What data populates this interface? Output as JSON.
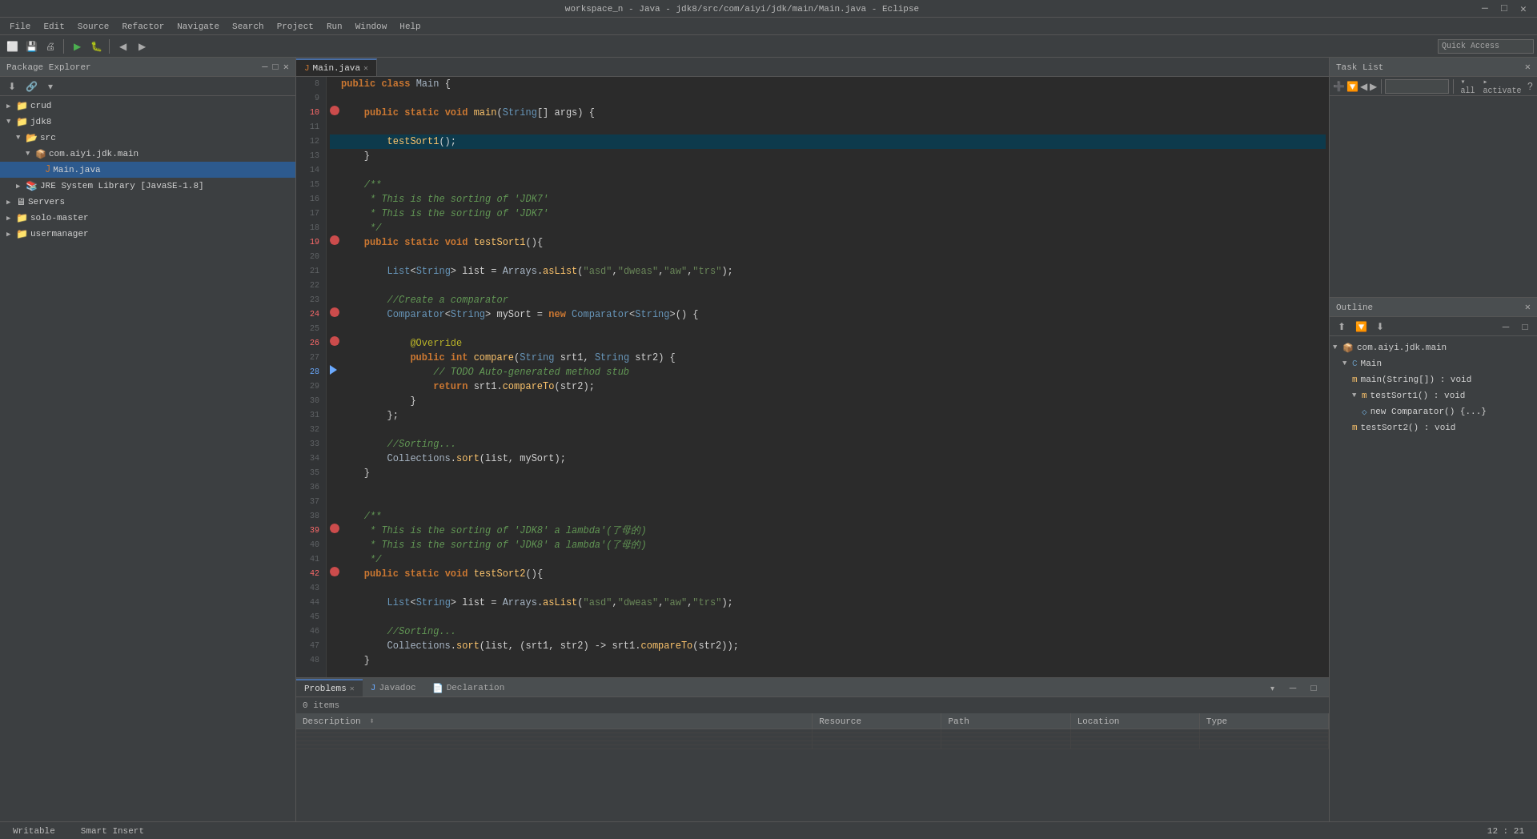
{
  "titleBar": {
    "title": "workspace_n - Java - jdk8/src/com/aiyi/jdk/main/Main.java - Eclipse",
    "minimize": "─",
    "maximize": "□",
    "close": "✕"
  },
  "menuBar": {
    "items": [
      "File",
      "Edit",
      "Source",
      "Refactor",
      "Navigate",
      "Search",
      "Project",
      "Run",
      "Window",
      "Help"
    ]
  },
  "toolbar": {
    "quickAccessPlaceholder": "Quick Access"
  },
  "leftPanel": {
    "title": "Package Explorer",
    "treeItems": [
      {
        "label": "crud",
        "level": 1,
        "expanded": true,
        "type": "project",
        "icon": "📁"
      },
      {
        "label": "jdk8",
        "level": 1,
        "expanded": true,
        "type": "project",
        "icon": "📁"
      },
      {
        "label": "src",
        "level": 2,
        "expanded": true,
        "type": "folder",
        "icon": "📂"
      },
      {
        "label": "com.aiyi.jdk.main",
        "level": 3,
        "expanded": true,
        "type": "package",
        "icon": "📦"
      },
      {
        "label": "Main.java",
        "level": 4,
        "expanded": false,
        "type": "file",
        "icon": "☕",
        "selected": true
      },
      {
        "label": "JRE System Library [JavaSE-1.8]",
        "level": 2,
        "expanded": false,
        "type": "library",
        "icon": "📚"
      },
      {
        "label": "Servers",
        "level": 1,
        "expanded": false,
        "type": "folder",
        "icon": "🖥"
      },
      {
        "label": "solo-master",
        "level": 1,
        "expanded": false,
        "type": "project",
        "icon": "📁"
      },
      {
        "label": "usermanager",
        "level": 1,
        "expanded": false,
        "type": "project",
        "icon": "📁"
      }
    ]
  },
  "editorTab": {
    "fileName": "Main.java",
    "active": true
  },
  "codeLines": [
    {
      "num": 8,
      "content": "public class Main {",
      "type": "normal"
    },
    {
      "num": 9,
      "content": "",
      "type": "normal"
    },
    {
      "num": 10,
      "content": "    public static void main(String[] args) {",
      "type": "breakpoint"
    },
    {
      "num": 11,
      "content": "",
      "type": "normal"
    },
    {
      "num": 12,
      "content": "        testSort1();",
      "type": "current"
    },
    {
      "num": 13,
      "content": "    }",
      "type": "normal"
    },
    {
      "num": 14,
      "content": "",
      "type": "normal"
    },
    {
      "num": 15,
      "content": "    /**",
      "type": "normal"
    },
    {
      "num": 16,
      "content": "     * This is the sorting of 'JDK7'",
      "type": "normal"
    },
    {
      "num": 17,
      "content": "     * This is the sorting of 'JDK7'",
      "type": "normal"
    },
    {
      "num": 18,
      "content": "     */",
      "type": "normal"
    },
    {
      "num": 19,
      "content": "    public static void testSort1(){",
      "type": "breakpoint"
    },
    {
      "num": 20,
      "content": "",
      "type": "normal"
    },
    {
      "num": 21,
      "content": "        List<String> list = Arrays.asList(\"asd\",\"dweas\",\"aw\",\"trs\");",
      "type": "normal"
    },
    {
      "num": 22,
      "content": "",
      "type": "normal"
    },
    {
      "num": 23,
      "content": "        //Create a comparator",
      "type": "normal"
    },
    {
      "num": 24,
      "content": "        Comparator<String> mySort = new Comparator<String>() {",
      "type": "breakpoint"
    },
    {
      "num": 25,
      "content": "",
      "type": "normal"
    },
    {
      "num": 26,
      "content": "            @Override",
      "type": "breakpoint"
    },
    {
      "num": 27,
      "content": "            public int compare(String srt1, String str2) {",
      "type": "normal"
    },
    {
      "num": 28,
      "content": "                // TODO Auto-generated method stub",
      "type": "bookmark"
    },
    {
      "num": 29,
      "content": "                return srt1.compareTo(str2);",
      "type": "normal"
    },
    {
      "num": 30,
      "content": "            }",
      "type": "normal"
    },
    {
      "num": 31,
      "content": "        };",
      "type": "normal"
    },
    {
      "num": 32,
      "content": "",
      "type": "normal"
    },
    {
      "num": 33,
      "content": "        //Sorting...",
      "type": "normal"
    },
    {
      "num": 34,
      "content": "        Collections.sort(list, mySort);",
      "type": "normal"
    },
    {
      "num": 35,
      "content": "    }",
      "type": "normal"
    },
    {
      "num": 36,
      "content": "",
      "type": "normal"
    },
    {
      "num": 37,
      "content": "",
      "type": "normal"
    },
    {
      "num": 38,
      "content": "    /**",
      "type": "normal"
    },
    {
      "num": 39,
      "content": "     * This is the sorting of 'JDK8' a lambda'(了母的)",
      "type": "breakpoint"
    },
    {
      "num": 40,
      "content": "     * This is the sorting of 'JDK8' a lambda'(了母的)",
      "type": "normal"
    },
    {
      "num": 41,
      "content": "     */",
      "type": "normal"
    },
    {
      "num": 42,
      "content": "    public static void testSort2(){",
      "type": "breakpoint"
    },
    {
      "num": 43,
      "content": "",
      "type": "normal"
    },
    {
      "num": 44,
      "content": "        List<String> list = Arrays.asList(\"asd\",\"dweas\",\"aw\",\"trs\");",
      "type": "normal"
    },
    {
      "num": 45,
      "content": "",
      "type": "normal"
    },
    {
      "num": 46,
      "content": "        //Sorting...",
      "type": "normal"
    },
    {
      "num": 47,
      "content": "        Collections.sort(list, (srt1, str2) -> srt1.compareTo(str2));",
      "type": "normal"
    },
    {
      "num": 48,
      "content": "    }",
      "type": "normal"
    }
  ],
  "bottomPanel": {
    "tabs": [
      {
        "label": "Problems",
        "active": true,
        "closeable": true
      },
      {
        "label": "Javadoc",
        "active": false,
        "closeable": false
      },
      {
        "label": "Declaration",
        "active": false,
        "closeable": false
      }
    ],
    "problemsCount": "0 items",
    "tableHeaders": [
      "Description",
      "Resource",
      "Path",
      "Location",
      "Type"
    ]
  },
  "taskListPanel": {
    "title": "Task List",
    "filterOptions": [
      "▾ all",
      "▸ activate"
    ]
  },
  "outlinePanel": {
    "title": "Outline",
    "items": [
      {
        "label": "com.aiyi.jdk.main",
        "level": 0,
        "type": "package",
        "expanded": true
      },
      {
        "label": "Main",
        "level": 1,
        "type": "class",
        "expanded": true
      },
      {
        "label": "main(String[]) : void",
        "level": 2,
        "type": "method"
      },
      {
        "label": "testSort1() : void",
        "level": 2,
        "type": "method",
        "expanded": true
      },
      {
        "label": "new Comparator() {...}",
        "level": 3,
        "type": "anon"
      },
      {
        "label": "testSort2() : void",
        "level": 2,
        "type": "method"
      }
    ]
  },
  "statusBar": {
    "writable": "Writable",
    "insertMode": "Smart Insert",
    "position": "12 : 21"
  }
}
